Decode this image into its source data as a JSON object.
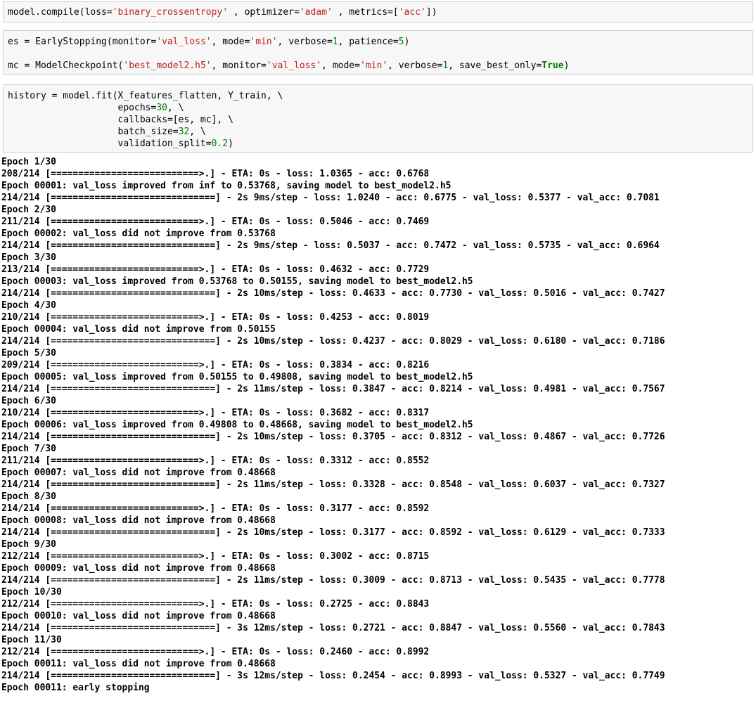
{
  "cells": [
    {
      "lines": [
        [
          {
            "t": "plain",
            "v": "model.compile(loss="
          },
          {
            "t": "str",
            "v": "'binary_crossentropy'"
          },
          {
            "t": "plain",
            "v": " , optimizer="
          },
          {
            "t": "str",
            "v": "'adam'"
          },
          {
            "t": "plain",
            "v": " , metrics=["
          },
          {
            "t": "str",
            "v": "'acc'"
          },
          {
            "t": "plain",
            "v": "])"
          }
        ]
      ]
    },
    {
      "lines": [
        [
          {
            "t": "plain",
            "v": "es = EarlyStopping(monitor="
          },
          {
            "t": "str",
            "v": "'val_loss'"
          },
          {
            "t": "plain",
            "v": ", mode="
          },
          {
            "t": "str",
            "v": "'min'"
          },
          {
            "t": "plain",
            "v": ", verbose="
          },
          {
            "t": "num",
            "v": "1"
          },
          {
            "t": "plain",
            "v": ", patience="
          },
          {
            "t": "num",
            "v": "5"
          },
          {
            "t": "plain",
            "v": ")"
          }
        ],
        [],
        [
          {
            "t": "plain",
            "v": "mc = ModelCheckpoint("
          },
          {
            "t": "str",
            "v": "'best_model2.h5'"
          },
          {
            "t": "plain",
            "v": ", monitor="
          },
          {
            "t": "str",
            "v": "'val_loss'"
          },
          {
            "t": "plain",
            "v": ", mode="
          },
          {
            "t": "str",
            "v": "'min'"
          },
          {
            "t": "plain",
            "v": ", verbose="
          },
          {
            "t": "num",
            "v": "1"
          },
          {
            "t": "plain",
            "v": ", save_best_only="
          },
          {
            "t": "kw",
            "v": "True"
          },
          {
            "t": "plain",
            "v": ")"
          }
        ]
      ]
    },
    {
      "lines": [
        [
          {
            "t": "plain",
            "v": "history = model.fit(X_features_flatten, Y_train, \\"
          }
        ],
        [
          {
            "t": "plain",
            "v": "                    epochs="
          },
          {
            "t": "num",
            "v": "30"
          },
          {
            "t": "plain",
            "v": ", \\"
          }
        ],
        [
          {
            "t": "plain",
            "v": "                    callbacks=[es, mc], \\"
          }
        ],
        [
          {
            "t": "plain",
            "v": "                    batch_size="
          },
          {
            "t": "num",
            "v": "32"
          },
          {
            "t": "plain",
            "v": ", \\"
          }
        ],
        [
          {
            "t": "plain",
            "v": "                    validation_split="
          },
          {
            "t": "num",
            "v": "0.2"
          },
          {
            "t": "plain",
            "v": ")"
          }
        ]
      ]
    }
  ],
  "output_lines": [
    "Epoch 1/30",
    "208/214 [===========================>.] - ETA: 0s - loss: 1.0365 - acc: 0.6768",
    "Epoch 00001: val_loss improved from inf to 0.53768, saving model to best_model2.h5",
    "214/214 [==============================] - 2s 9ms/step - loss: 1.0240 - acc: 0.6775 - val_loss: 0.5377 - val_acc: 0.7081",
    "Epoch 2/30",
    "211/214 [===========================>.] - ETA: 0s - loss: 0.5046 - acc: 0.7469",
    "Epoch 00002: val_loss did not improve from 0.53768",
    "214/214 [==============================] - 2s 9ms/step - loss: 0.5037 - acc: 0.7472 - val_loss: 0.5735 - val_acc: 0.6964",
    "Epoch 3/30",
    "213/214 [===========================>.] - ETA: 0s - loss: 0.4632 - acc: 0.7729",
    "Epoch 00003: val_loss improved from 0.53768 to 0.50155, saving model to best_model2.h5",
    "214/214 [==============================] - 2s 10ms/step - loss: 0.4633 - acc: 0.7730 - val_loss: 0.5016 - val_acc: 0.7427",
    "Epoch 4/30",
    "210/214 [===========================>.] - ETA: 0s - loss: 0.4253 - acc: 0.8019",
    "Epoch 00004: val_loss did not improve from 0.50155",
    "214/214 [==============================] - 2s 10ms/step - loss: 0.4237 - acc: 0.8029 - val_loss: 0.6180 - val_acc: 0.7186",
    "Epoch 5/30",
    "209/214 [===========================>.] - ETA: 0s - loss: 0.3834 - acc: 0.8216",
    "Epoch 00005: val_loss improved from 0.50155 to 0.49808, saving model to best_model2.h5",
    "214/214 [==============================] - 2s 11ms/step - loss: 0.3847 - acc: 0.8214 - val_loss: 0.4981 - val_acc: 0.7567",
    "Epoch 6/30",
    "210/214 [===========================>.] - ETA: 0s - loss: 0.3682 - acc: 0.8317",
    "Epoch 00006: val_loss improved from 0.49808 to 0.48668, saving model to best_model2.h5",
    "214/214 [==============================] - 2s 10ms/step - loss: 0.3705 - acc: 0.8312 - val_loss: 0.4867 - val_acc: 0.7726",
    "Epoch 7/30",
    "211/214 [===========================>.] - ETA: 0s - loss: 0.3312 - acc: 0.8552",
    "Epoch 00007: val_loss did not improve from 0.48668",
    "214/214 [==============================] - 2s 11ms/step - loss: 0.3328 - acc: 0.8548 - val_loss: 0.6037 - val_acc: 0.7327",
    "Epoch 8/30",
    "214/214 [===========================>.] - ETA: 0s - loss: 0.3177 - acc: 0.8592",
    "Epoch 00008: val_loss did not improve from 0.48668",
    "214/214 [==============================] - 2s 10ms/step - loss: 0.3177 - acc: 0.8592 - val_loss: 0.6129 - val_acc: 0.7333",
    "Epoch 9/30",
    "212/214 [===========================>.] - ETA: 0s - loss: 0.3002 - acc: 0.8715",
    "Epoch 00009: val_loss did not improve from 0.48668",
    "214/214 [==============================] - 2s 11ms/step - loss: 0.3009 - acc: 0.8713 - val_loss: 0.5435 - val_acc: 0.7778",
    "Epoch 10/30",
    "212/214 [===========================>.] - ETA: 0s - loss: 0.2725 - acc: 0.8843",
    "Epoch 00010: val_loss did not improve from 0.48668",
    "214/214 [==============================] - 3s 12ms/step - loss: 0.2721 - acc: 0.8847 - val_loss: 0.5560 - val_acc: 0.7843",
    "Epoch 11/30",
    "212/214 [===========================>.] - ETA: 0s - loss: 0.2460 - acc: 0.8992",
    "Epoch 00011: val_loss did not improve from 0.48668",
    "214/214 [==============================] - 3s 12ms/step - loss: 0.2454 - acc: 0.8993 - val_loss: 0.5327 - val_acc: 0.7749",
    "Epoch 00011: early stopping"
  ]
}
